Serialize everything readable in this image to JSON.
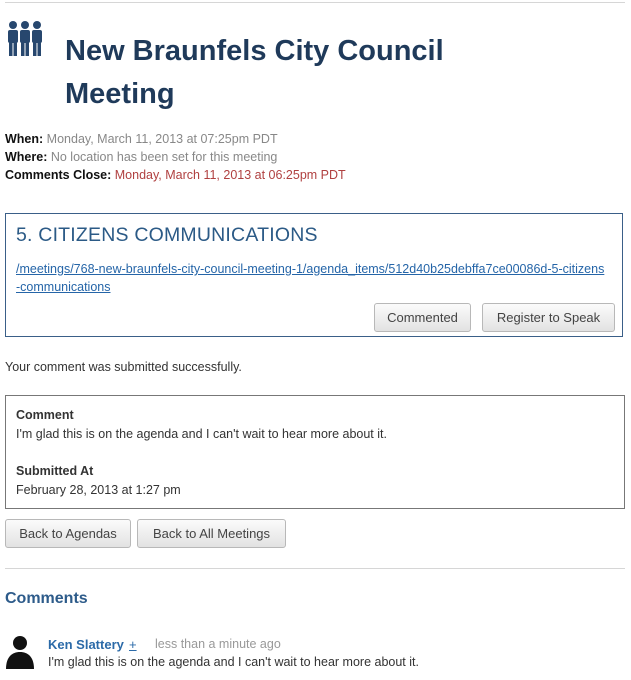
{
  "header": {
    "title": "New Braunfels City Council Meeting",
    "logo_icon": "group-people-icon"
  },
  "meta": {
    "when_label": "When:",
    "when_value": "Monday, March 11, 2013 at 07:25pm PDT",
    "where_label": "Where:",
    "where_value": "No location has been set for this meeting",
    "close_label": "Comments Close:",
    "close_value": "Monday, March 11, 2013 at 06:25pm PDT"
  },
  "agenda_item": {
    "title": "5. CITIZENS COMMUNICATIONS",
    "link": "/meetings/768-new-braunfels-city-council-meeting-1/agenda_items/512d40b25debffa7ce00086d-5-citizens-communications",
    "commented_label": "Commented",
    "register_label": "Register to Speak"
  },
  "status": {
    "message": "Your comment was submitted successfully."
  },
  "submitted_comment": {
    "comment_label": "Comment",
    "comment_text": "I'm glad this is on the agenda and I can't wait to hear more about it.",
    "submitted_label": "Submitted At",
    "submitted_value": "February 28, 2013 at 1:27 pm"
  },
  "nav": {
    "back_agendas": "Back to Agendas",
    "back_all": "Back to All Meetings"
  },
  "comments": {
    "heading": "Comments",
    "items": [
      {
        "author": "Ken Slattery",
        "plus": "+",
        "time": "less than a minute ago",
        "text": "I'm glad this is on the agenda and I can't wait to hear more about it."
      }
    ]
  },
  "colors": {
    "title": "#1f3a5a",
    "accent_blue": "#2b5a86",
    "link": "#2565a8",
    "deadline_red": "#b04040"
  }
}
